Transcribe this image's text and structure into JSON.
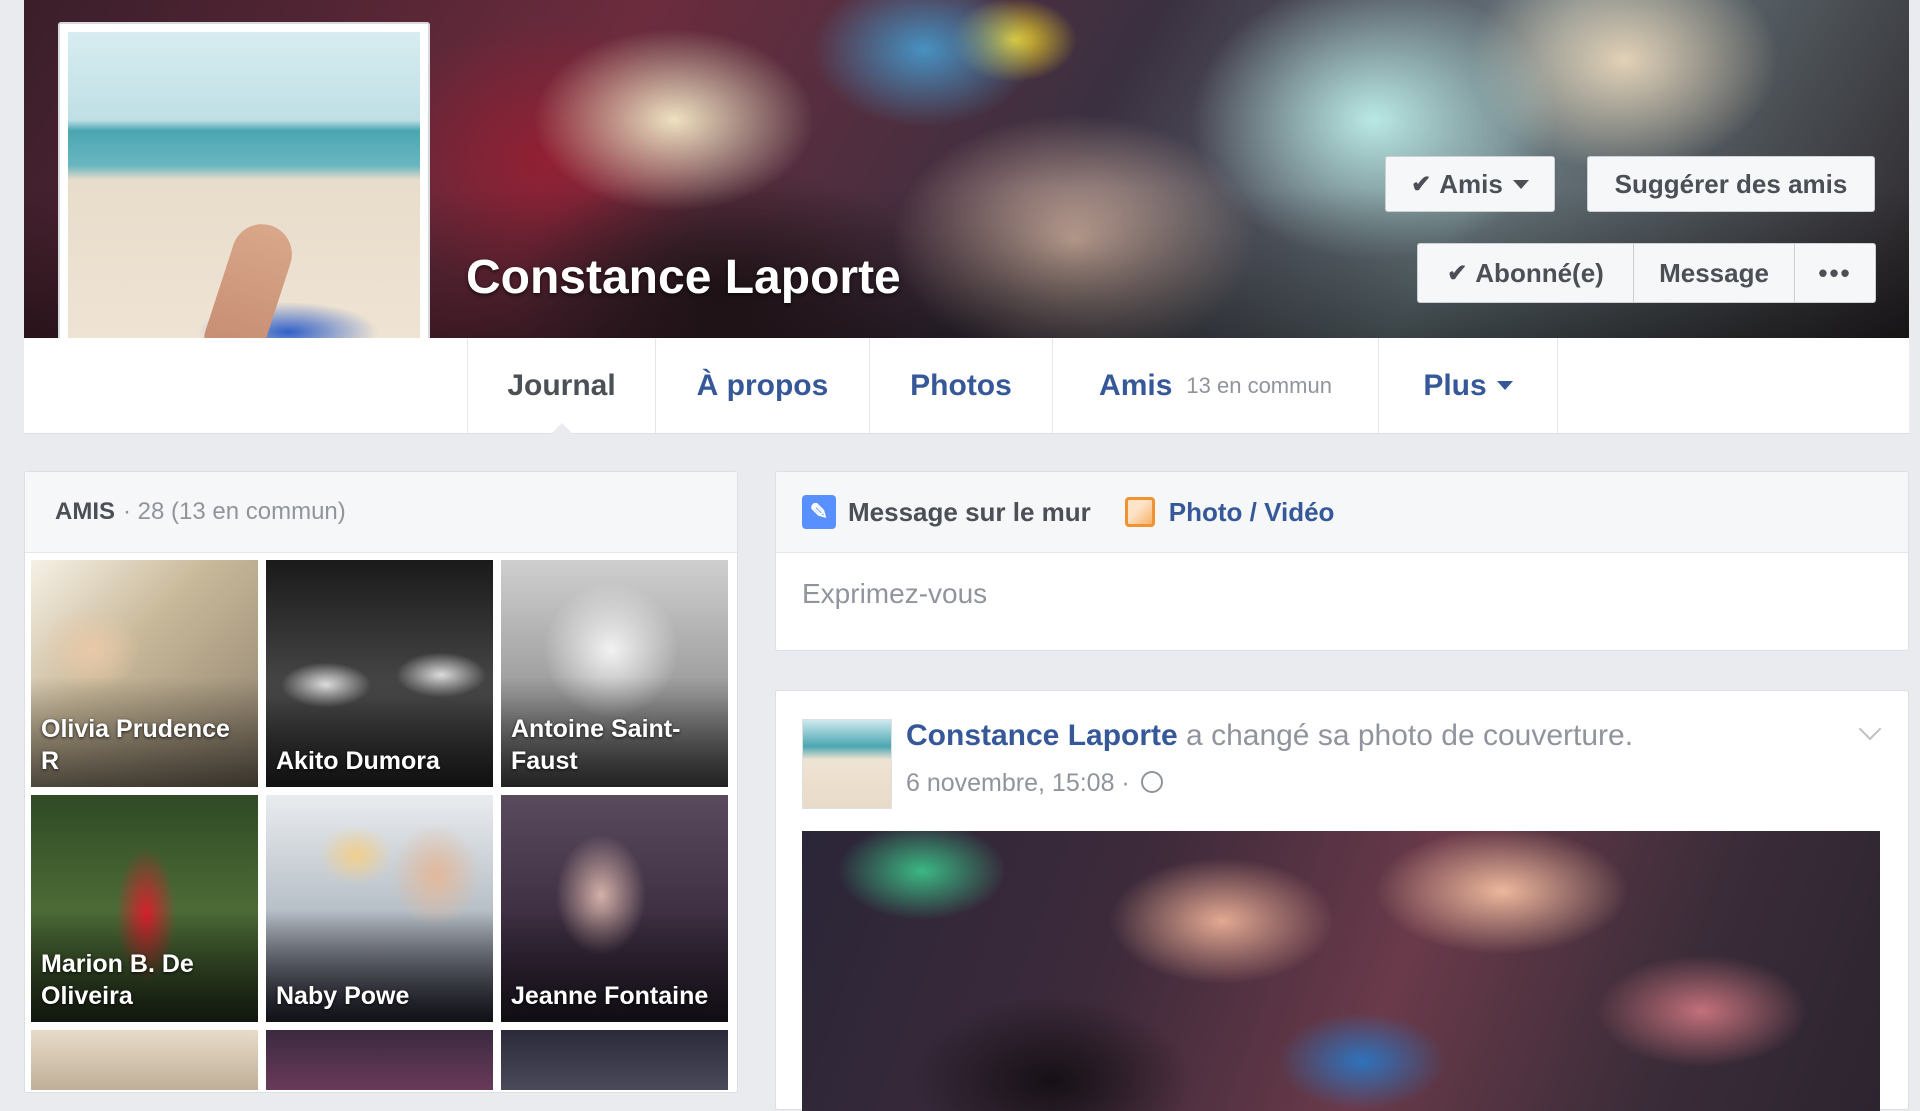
{
  "profile": {
    "name": "Constance Laporte"
  },
  "header_buttons": {
    "friends": "Amis",
    "suggest": "Suggérer des amis",
    "subscribed": "Abonné(e)",
    "message": "Message",
    "more": "•••"
  },
  "tabs": {
    "journal": "Journal",
    "about": "À propos",
    "photos": "Photos",
    "friends": "Amis",
    "friends_mutual": "13 en commun",
    "more": "Plus"
  },
  "friends_box": {
    "label": "AMIS",
    "count": "· 28 (13 en commun)",
    "friends": [
      {
        "name": "Olivia Prudence R"
      },
      {
        "name": "Akito Dumora"
      },
      {
        "name": "Antoine Saint-Faust"
      },
      {
        "name": "Marion B. De Oliveira"
      },
      {
        "name": "Naby Powe"
      },
      {
        "name": "Jeanne Fontaine"
      }
    ]
  },
  "composer": {
    "wall_tab": "Message sur le mur",
    "photo_tab": "Photo / Vidéo",
    "placeholder": "Exprimez-vous"
  },
  "post": {
    "author": "Constance Laporte",
    "action": " a changé sa photo de couverture.",
    "timestamp": "6 novembre, 15:08 ·"
  },
  "colors": {
    "link_blue": "#365899",
    "page_bg": "#e9ebee",
    "pencil_icon": "#5890ff",
    "photo_icon": "#f09433"
  }
}
